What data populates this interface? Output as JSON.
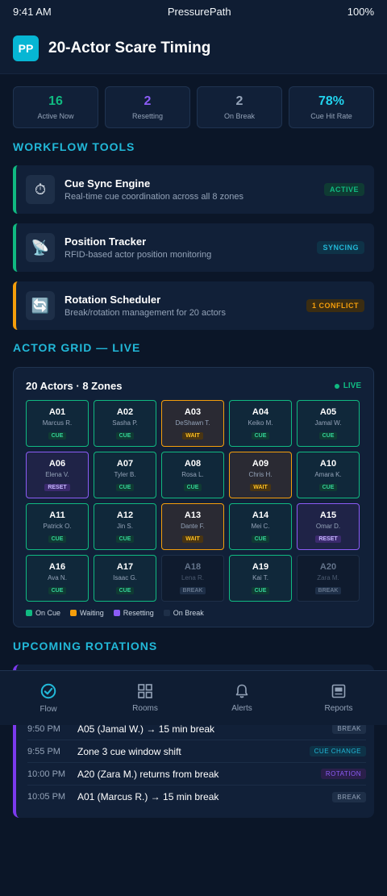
{
  "status_bar": {
    "time": "9:41 AM",
    "app_name": "PressurePath",
    "battery": "100%"
  },
  "header": {
    "logo_text": "PP",
    "title": "20-Actor Scare Timing"
  },
  "stats": [
    {
      "value": "16",
      "label": "Active Now",
      "color": "#10b981"
    },
    {
      "value": "2",
      "label": "Resetting",
      "color": "#8b5cf6"
    },
    {
      "value": "2",
      "label": "On Break",
      "color": "#94a3b8"
    },
    {
      "value": "78%",
      "label": "Cue Hit Rate",
      "color": "#22d3ee"
    }
  ],
  "sections": {
    "workflow": "WORKFLOW TOOLS",
    "grid": "ACTOR GRID — LIVE",
    "rotations": "UPCOMING ROTATIONS"
  },
  "tools": [
    {
      "name": "Cue Sync Engine",
      "desc": "Real-time cue coordination across all 8 zones",
      "badge": "ACTIVE",
      "icon": "⏱",
      "accent": "#10b981",
      "badge_bg": "#0f3b33",
      "badge_fg": "#10b981"
    },
    {
      "name": "Position Tracker",
      "desc": "RFID-based actor position monitoring",
      "badge": "SYNCING",
      "icon": "📡",
      "accent": "#10b981",
      "badge_bg": "#0e3247",
      "badge_fg": "#22b8d8"
    },
    {
      "name": "Rotation Scheduler",
      "desc": "Break/rotation management for 20 actors",
      "badge": "1 CONFLICT",
      "icon": "🔄",
      "accent": "#f59e0b",
      "badge_bg": "#3b2d12",
      "badge_fg": "#f59e0b"
    }
  ],
  "grid": {
    "title": "20 Actors · 8 Zones",
    "live_label": "LIVE",
    "actors": [
      {
        "id": "A01",
        "name": "Marcus R.",
        "state": "CUE"
      },
      {
        "id": "A02",
        "name": "Sasha P.",
        "state": "CUE"
      },
      {
        "id": "A03",
        "name": "DeShawn T.",
        "state": "WAIT"
      },
      {
        "id": "A04",
        "name": "Keiko M.",
        "state": "CUE"
      },
      {
        "id": "A05",
        "name": "Jamal W.",
        "state": "CUE"
      },
      {
        "id": "A06",
        "name": "Elena V.",
        "state": "RESET"
      },
      {
        "id": "A07",
        "name": "Tyler B.",
        "state": "CUE"
      },
      {
        "id": "A08",
        "name": "Rosa L.",
        "state": "CUE"
      },
      {
        "id": "A09",
        "name": "Chris H.",
        "state": "WAIT"
      },
      {
        "id": "A10",
        "name": "Amara K.",
        "state": "CUE"
      },
      {
        "id": "A11",
        "name": "Patrick O.",
        "state": "CUE"
      },
      {
        "id": "A12",
        "name": "Jin S.",
        "state": "CUE"
      },
      {
        "id": "A13",
        "name": "Dante F.",
        "state": "WAIT"
      },
      {
        "id": "A14",
        "name": "Mei C.",
        "state": "CUE"
      },
      {
        "id": "A15",
        "name": "Omar D.",
        "state": "RESET"
      },
      {
        "id": "A16",
        "name": "Ava N.",
        "state": "CUE"
      },
      {
        "id": "A17",
        "name": "Isaac G.",
        "state": "CUE"
      },
      {
        "id": "A18",
        "name": "Lena R.",
        "state": "BREAK"
      },
      {
        "id": "A19",
        "name": "Kai T.",
        "state": "CUE"
      },
      {
        "id": "A20",
        "name": "Zara M.",
        "state": "BREAK"
      }
    ],
    "legend": [
      {
        "label": "On Cue",
        "color": "#10b981"
      },
      {
        "label": "Waiting",
        "color": "#f59e0b"
      },
      {
        "label": "Resetting",
        "color": "#8b5cf6"
      },
      {
        "label": "On Break",
        "color": "#1e2f48"
      }
    ]
  },
  "rotations": [
    {
      "time": "9:50 PM",
      "text": "A05 (Jamal W.) → 15 min break",
      "tag": "BREAK",
      "tag_bg": "#1e2f48",
      "tag_fg": "#94a3b8"
    },
    {
      "time": "9:55 PM",
      "text": "Zone 3 cue window shift",
      "tag": "CUE CHANGE",
      "tag_bg": "#0e3247",
      "tag_fg": "#22b8d8"
    },
    {
      "time": "10:00 PM",
      "text": "A20 (Zara M.) returns from break",
      "tag": "ROTATION",
      "tag_bg": "#2a1f4a",
      "tag_fg": "#8b5cf6"
    },
    {
      "time": "10:05 PM",
      "text": "A01 (Marcus R.) → 15 min break",
      "tag": "BREAK",
      "tag_bg": "#1e2f48",
      "tag_fg": "#94a3b8"
    }
  ],
  "nav": [
    {
      "label": "Flow",
      "icon": "check-circle-icon",
      "active": true
    },
    {
      "label": "Rooms",
      "icon": "grid-icon",
      "active": false
    },
    {
      "label": "Alerts",
      "icon": "bell-icon",
      "active": false
    },
    {
      "label": "Reports",
      "icon": "report-icon",
      "active": false
    }
  ]
}
